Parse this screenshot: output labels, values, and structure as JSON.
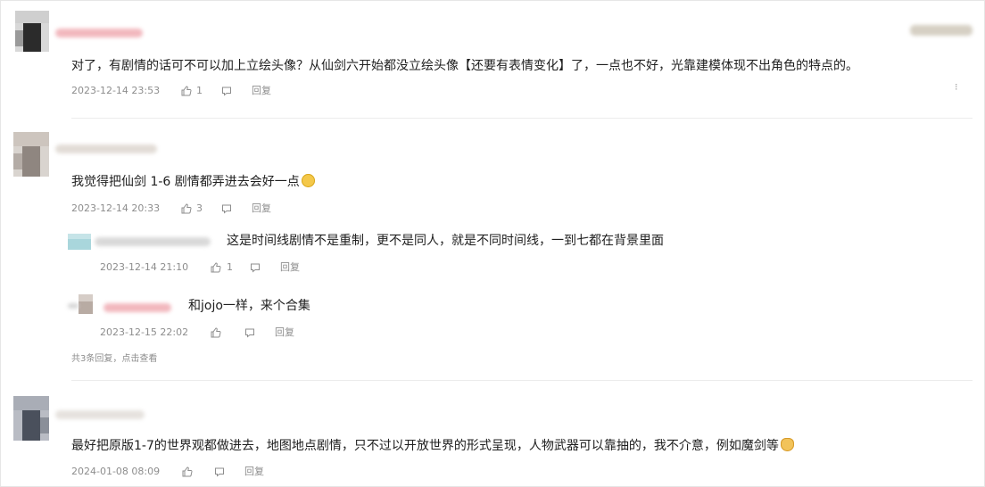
{
  "comments": [
    {
      "text": "对了，有剧情的话可不可以加上立绘头像？从仙剑六开始都没立绘头像【还要有表情变化】了，一点也不好，光靠建模体现不出角色的特点的。",
      "time": "2023-12-14 23:53",
      "likes": "1",
      "reply_label": "回复"
    },
    {
      "text": "我觉得把仙剑 1-6 剧情都弄进去会好一点",
      "time": "2023-12-14 20:33",
      "likes": "3",
      "reply_label": "回复",
      "replies": [
        {
          "text": "这是时间线剧情不是重制，更不是同人，就是不同时间线，一到七都在背景里面",
          "time": "2023-12-14 21:10",
          "likes": "1",
          "reply_label": "回复"
        },
        {
          "text": "和jojo一样，来个合集",
          "time": "2023-12-15 22:02",
          "reply_label": "回复"
        }
      ],
      "more_replies": "共3条回复，点击查看"
    },
    {
      "text": "最好把原版1-7的世界观都做进去，地图地点剧情，只不过以开放世界的形式呈现，人物武器可以靠抽的，我不介意，例如魔剑等",
      "time": "2024-01-08 08:09",
      "reply_label": "回复"
    }
  ],
  "colors": {
    "text": "#202020",
    "meta": "#8d8d8d",
    "divider": "#ececec",
    "name_pink": "#f2b8be",
    "name_gray": "#cfcfcf",
    "name_teal": "#a9d6dc"
  },
  "icons": [
    "like-icon",
    "comment-icon",
    "more-options-icon",
    "smiley-emoji-icon",
    "cat-emoji-icon"
  ]
}
